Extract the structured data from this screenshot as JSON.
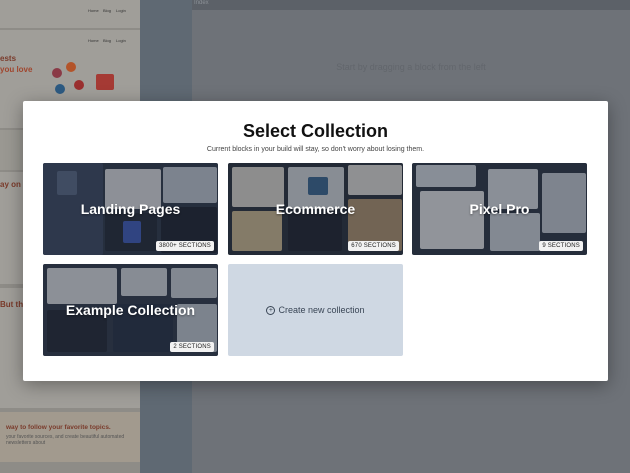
{
  "background": {
    "canvas_hint": "Start by dragging a block from the left",
    "topbar_label": "Index",
    "left_texts": {
      "headline1": "ests",
      "headline2": "you love",
      "headline3": "ay on",
      "headline4": "But the",
      "headline5": "way to follow your favorite topics.",
      "sub5": "your favorite sources, and create beautiful automated newsletters about"
    },
    "nav_links": [
      "Home",
      "Blog",
      "Login"
    ]
  },
  "modal": {
    "title": "Select Collection",
    "subtitle": "Current blocks in your build will stay, so don't worry about losing them.",
    "collections": [
      {
        "name": "Landing Pages",
        "count": "3800+ SECTIONS"
      },
      {
        "name": "Ecommerce",
        "count": "670 SECTIONS"
      },
      {
        "name": "Pixel Pro",
        "count": "9 SECTIONS"
      },
      {
        "name": "Example Collection",
        "count": "2 SECTIONS"
      }
    ],
    "new_collection_label": "Create new collection"
  },
  "colors": {
    "modal_bg": "#ffffff",
    "new_card_bg": "#cfd8e3",
    "badge_bg": "#f2f2f2"
  }
}
